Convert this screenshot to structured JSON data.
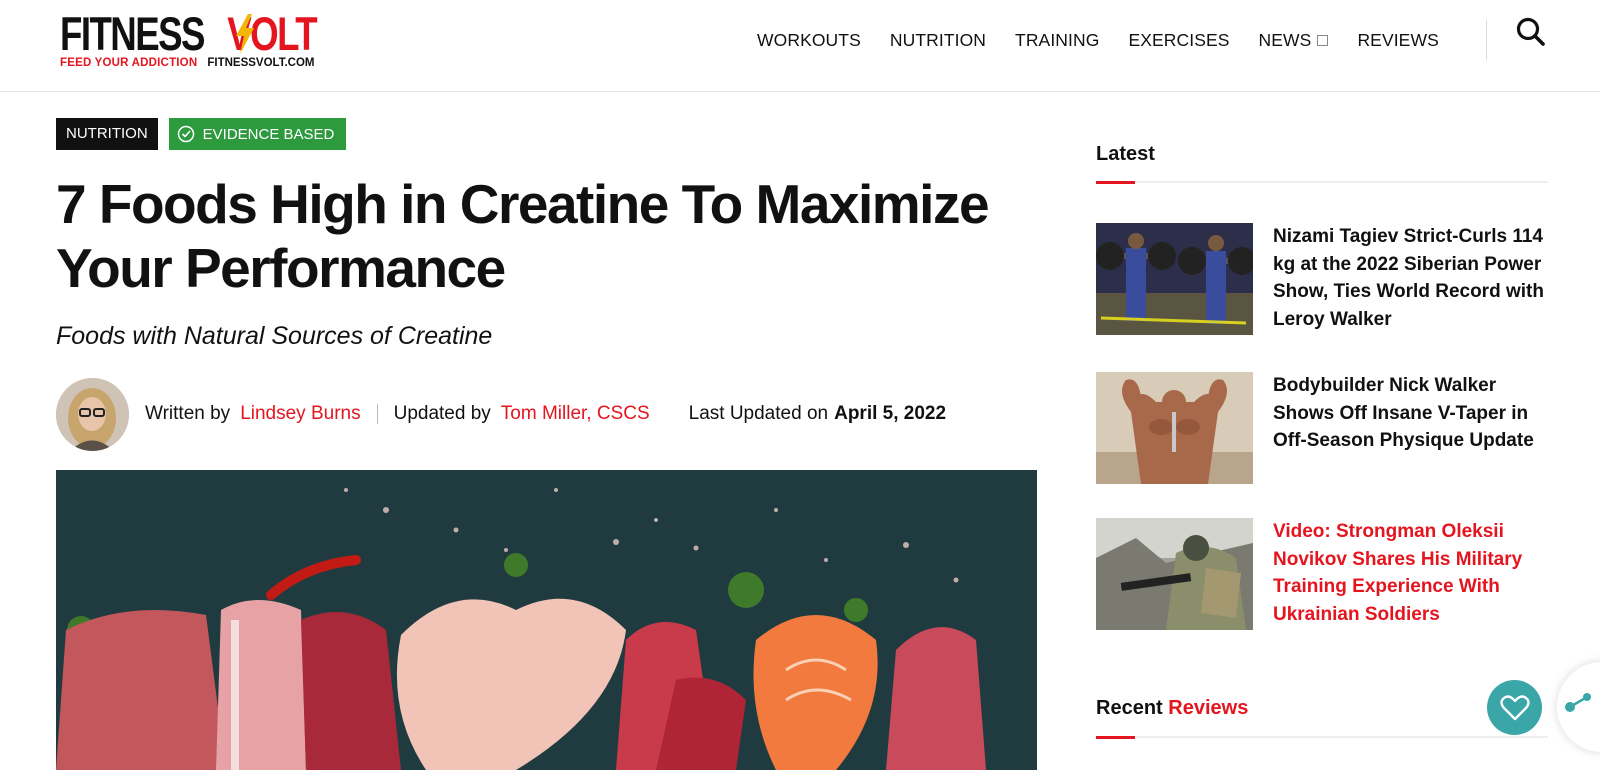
{
  "brand": {
    "name_part1": "FITNESS",
    "name_part2": "VOLT",
    "tagline": "FEED YOUR ADDICTION",
    "domain": "FITNESSVOLT.COM",
    "colors": {
      "accent": "#e4151f",
      "evidence": "#2d9a3e",
      "fab": "#3aa6a8"
    }
  },
  "nav": {
    "items": [
      "WORKOUTS",
      "NUTRITION",
      "TRAINING",
      "EXERCISES",
      "NEWS",
      "REVIEWS"
    ],
    "search_icon": "search-icon"
  },
  "article": {
    "category": "NUTRITION",
    "evidence_badge": "EVIDENCE BASED",
    "title": "7 Foods High in Creatine To Maximize Your Performance",
    "subtitle": "Foods with Natural Sources of Creatine",
    "byline": {
      "written_label": "Written by",
      "author": "Lindsey Burns",
      "updated_label": "Updated by",
      "updater": "Tom Miller, CSCS",
      "last_updated_label": "Last Updated on",
      "date": "April 5, 2022"
    }
  },
  "sidebar": {
    "latest_heading": "Latest",
    "latest": [
      {
        "title": "Nizami Tagiev Strict-Curls 114 kg at the 2022 Siberian Power Show, Ties World Record with Leroy Walker"
      },
      {
        "title": "Bodybuilder Nick Walker Shows Off Insane V-Taper in Off-Season Physique Update"
      },
      {
        "title": "Video: Strongman Oleksii Novikov Shares His Military Training Experience With Ukrainian Soldiers"
      }
    ],
    "recent_heading_part1": "Recent",
    "recent_heading_part2": "Reviews"
  }
}
